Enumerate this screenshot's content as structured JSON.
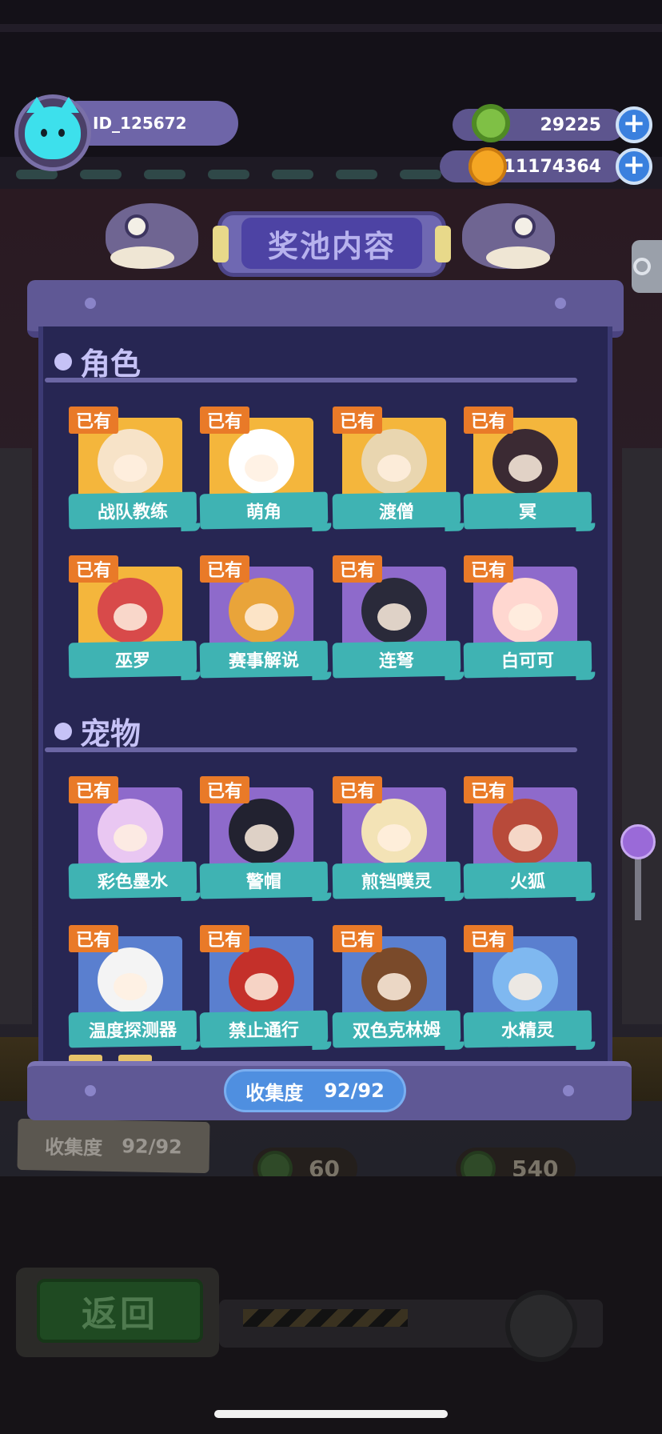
{
  "hud": {
    "player_id": "ID_125672",
    "currencies": [
      {
        "name": "green-coin",
        "value": "29225",
        "color": "#7fc045"
      },
      {
        "name": "gold-planet",
        "value": "11174364",
        "color": "#f5a623"
      }
    ],
    "plus_symbol": "+"
  },
  "modal": {
    "title": "奖池内容",
    "sections": [
      {
        "title": "角色",
        "items": [
          {
            "name": "战队教练",
            "badge": "已有",
            "bg": "gold"
          },
          {
            "name": "萌角",
            "badge": "已有",
            "bg": "gold"
          },
          {
            "name": "渡僧",
            "badge": "已有",
            "bg": "gold"
          },
          {
            "name": "冥",
            "badge": "已有",
            "bg": "gold"
          },
          {
            "name": "巫罗",
            "badge": "已有",
            "bg": "gold"
          },
          {
            "name": "赛事解说",
            "badge": "已有",
            "bg": "purple"
          },
          {
            "name": "连弩",
            "badge": "已有",
            "bg": "purple"
          },
          {
            "name": "白可可",
            "badge": "已有",
            "bg": "purple"
          }
        ]
      },
      {
        "title": "宠物",
        "items": [
          {
            "name": "彩色墨水",
            "badge": "已有",
            "bg": "purple"
          },
          {
            "name": "警帽",
            "badge": "已有",
            "bg": "purple"
          },
          {
            "name": "煎铛噗灵",
            "badge": "已有",
            "bg": "purple"
          },
          {
            "name": "火狐",
            "badge": "已有",
            "bg": "purple"
          },
          {
            "name": "温度探测器",
            "badge": "已有",
            "bg": "blue"
          },
          {
            "name": "禁止通行",
            "badge": "已有",
            "bg": "blue"
          },
          {
            "name": "双色克林姆",
            "badge": "已有",
            "bg": "blue"
          },
          {
            "name": "水精灵",
            "badge": "已有",
            "bg": "blue"
          }
        ]
      }
    ],
    "collection_label": "收集度",
    "collection_value": "92/92"
  },
  "background": {
    "collection_label": "收集度",
    "collection_value": "92/92",
    "prices": [
      "60",
      "540"
    ],
    "back_label": "返回"
  }
}
